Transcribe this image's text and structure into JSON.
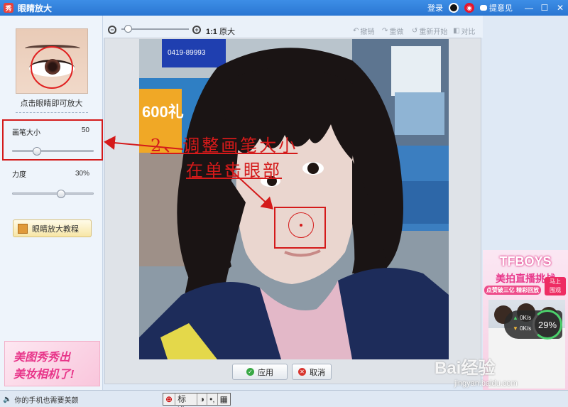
{
  "window": {
    "title": "眼睛放大",
    "app_icon_glyph": "秀",
    "login": "登录",
    "feedback": "提意见"
  },
  "left": {
    "eye_caption": "点击眼睛即可放大",
    "brush_size_label": "画笔大小",
    "brush_size_value": "50",
    "brush_size_level": 0.3,
    "strength_label": "力度",
    "strength_value": "30%",
    "strength_level": 0.6,
    "tutorial_label": "眼睛放大教程",
    "ad_line1": "美图秀秀出",
    "ad_line2": "美妆相机了!"
  },
  "toolbar": {
    "ratio_bold": "1:1",
    "ratio_text": "原大",
    "undo": "撤销",
    "redo": "重做",
    "restart": "重新开始",
    "compare": "对比",
    "zoom_level": 0.1
  },
  "photo": {
    "banner_text": "0419-89993",
    "sign_text": "600礼"
  },
  "buttons": {
    "apply": "应用",
    "cancel": "取消"
  },
  "ad_right": {
    "brand": "TFBOYS",
    "line1": "美拍直播挑战",
    "line2": "点赞破三亿 精彩回放",
    "cta_line1": "马上",
    "cta_line2": "围观"
  },
  "speed_widget": {
    "up": "0K/s",
    "down": "0K/s",
    "percent": "29%"
  },
  "status": {
    "text": "你的手机也需要美颜",
    "ime_label": "标准"
  },
  "watermark": {
    "brand": "Bai经验",
    "url": "jingyan.baidu.com"
  },
  "annotations": {
    "line1": "2、调整画笔大小",
    "line2": "在单击眼部",
    "color": "#d41a1a"
  }
}
